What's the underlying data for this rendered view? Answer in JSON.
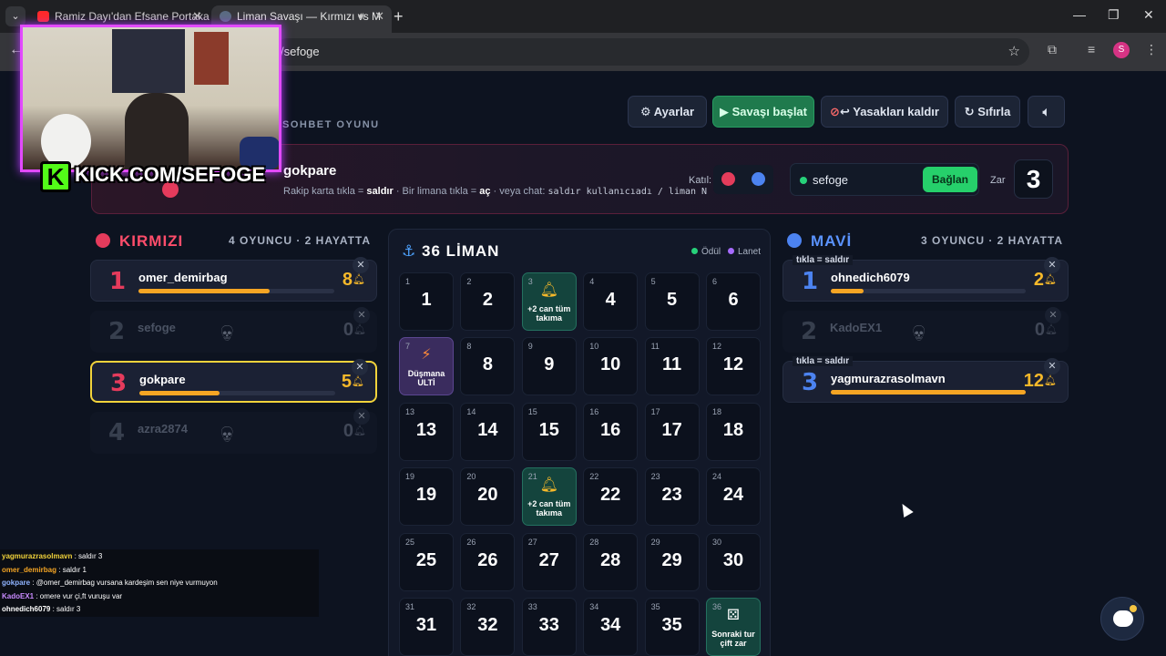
{
  "browser": {
    "tabs": [
      {
        "title": "Ramiz Dayı'dan Efsane Portakal",
        "active": false
      },
      {
        "title": "Liman Savaşı — Kırmızı vs M",
        "active": true
      }
    ],
    "url": "/sefoge",
    "profile_initial": "S"
  },
  "overlay": {
    "kick_text": "KICK.COM/SEFOGE",
    "kick_logo": "K"
  },
  "toolbar": {
    "settings": "Ayarlar",
    "start": "Savaşı başlat",
    "clear_bans": "Yasakları kaldır",
    "reset": "Sıfırla",
    "subtitle": "SOHBET OYUNU"
  },
  "banner": {
    "name": "gokpare",
    "help_prefix": "Rakip karta tıkla =",
    "help_attack": "saldır",
    "help_mid": "· Bir limana tıkla =",
    "help_open": "aç",
    "help_chat": "· veya chat:",
    "help_code": "saldır kullanıcıadı / liman N",
    "join_label": "Katıl:",
    "username": "sefoge",
    "connect": "Bağlan",
    "dice_label": "Zar",
    "dice_value": "3"
  },
  "red_team": {
    "title": "KIRMIZI",
    "count": "4 OYUNCU · 2 HAYATTA",
    "color": "#e53b5c",
    "players": [
      {
        "num": "1",
        "name": "omer_demirbag",
        "lives": "8",
        "alive": true,
        "fill": 0.67
      },
      {
        "num": "2",
        "name": "sefoge",
        "lives": "0",
        "alive": false
      },
      {
        "num": "3",
        "name": "gokpare",
        "lives": "5",
        "alive": true,
        "fill": 0.41,
        "selected": true
      },
      {
        "num": "4",
        "name": "azra2874",
        "lives": "0",
        "alive": false
      }
    ]
  },
  "blue_team": {
    "title": "MAVİ",
    "count": "3 OYUNCU · 2 HAYATTA",
    "color": "#4c83f0",
    "players": [
      {
        "num": "1",
        "name": "ohnedich6079",
        "lives": "2",
        "alive": true,
        "fill": 0.17,
        "tag": "tıkla = saldır"
      },
      {
        "num": "2",
        "name": "KadoEX1",
        "lives": "0",
        "alive": false
      },
      {
        "num": "3",
        "name": "yagmurazrasolmavn",
        "lives": "12",
        "alive": true,
        "fill": 1.0,
        "tag": "tıkla = saldır"
      }
    ]
  },
  "board": {
    "title": "36 LİMAN",
    "legend_reward": "Ödül",
    "legend_curse": "Lanet",
    "cells": [
      {
        "n": "1",
        "big": "1"
      },
      {
        "n": "2",
        "big": "2"
      },
      {
        "n": "3",
        "type": "reward",
        "icon": "bell-icon",
        "label": "+2 can tüm takıma"
      },
      {
        "n": "4",
        "big": "4"
      },
      {
        "n": "5",
        "big": "5"
      },
      {
        "n": "6",
        "big": "6"
      },
      {
        "n": "7",
        "type": "curse",
        "icon": "bolt-icon",
        "label": "Düşmana ULTİ"
      },
      {
        "n": "8",
        "big": "8"
      },
      {
        "n": "9",
        "big": "9"
      },
      {
        "n": "10",
        "big": "10"
      },
      {
        "n": "11",
        "big": "11"
      },
      {
        "n": "12",
        "big": "12"
      },
      {
        "n": "13",
        "big": "13"
      },
      {
        "n": "14",
        "big": "14"
      },
      {
        "n": "15",
        "big": "15"
      },
      {
        "n": "16",
        "big": "16"
      },
      {
        "n": "17",
        "big": "17"
      },
      {
        "n": "18",
        "big": "18"
      },
      {
        "n": "19",
        "big": "19"
      },
      {
        "n": "20",
        "big": "20"
      },
      {
        "n": "21",
        "type": "reward",
        "icon": "bell-icon",
        "label": "+2 can tüm takıma"
      },
      {
        "n": "22",
        "big": "22"
      },
      {
        "n": "23",
        "big": "23"
      },
      {
        "n": "24",
        "big": "24"
      },
      {
        "n": "25",
        "big": "25"
      },
      {
        "n": "26",
        "big": "26"
      },
      {
        "n": "27",
        "big": "27"
      },
      {
        "n": "28",
        "big": "28"
      },
      {
        "n": "29",
        "big": "29"
      },
      {
        "n": "30",
        "big": "30"
      },
      {
        "n": "31",
        "big": "31"
      },
      {
        "n": "32",
        "big": "32"
      },
      {
        "n": "33",
        "big": "33"
      },
      {
        "n": "34",
        "big": "34"
      },
      {
        "n": "35",
        "big": "35"
      },
      {
        "n": "36",
        "type": "special",
        "icon": "dice-icon",
        "label": "Sonraki tur çift zar"
      }
    ]
  },
  "chat": [
    {
      "user": "yagmurazrasolmavn",
      "msg": ": saldır 3",
      "color": "#f2d33b"
    },
    {
      "user": "omer_demirbag",
      "msg": ": saldır 1",
      "color": "#f5a524"
    },
    {
      "user": "gokpare",
      "msg": ": @omer_demirbag vursana kardeşim sen niye vurmuyon",
      "color": "#8fb3ff"
    },
    {
      "user": "KadoEX1",
      "msg": ": omere vur çi,ft vuruşu var",
      "color": "#c98bff"
    },
    {
      "user": "ohnedich6079",
      "msg": ": saldır 3",
      "color": "#ffffff"
    }
  ]
}
